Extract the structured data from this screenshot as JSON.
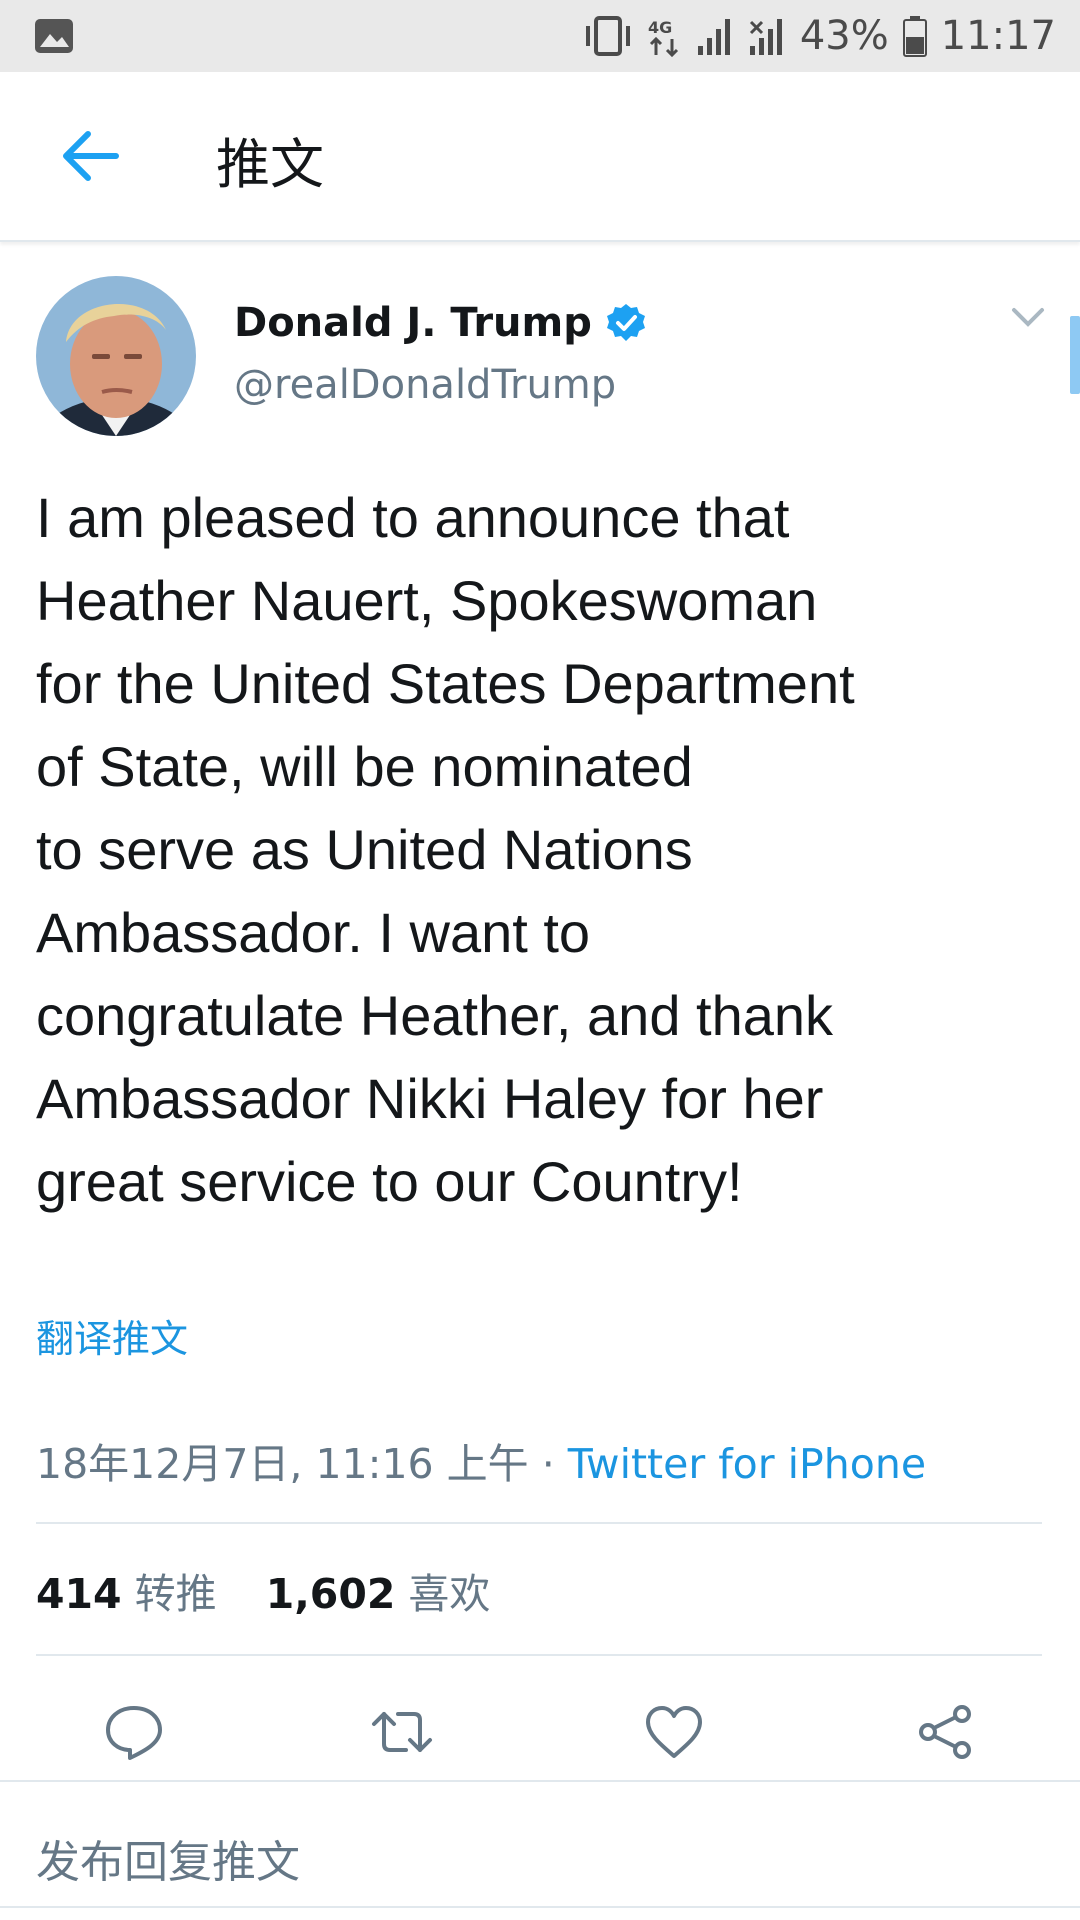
{
  "status_bar": {
    "battery_percent": "43%",
    "time": "11:17",
    "icons": [
      "gallery-notification-icon",
      "vibrate-icon",
      "data-transfer-icon",
      "signal-icon",
      "signal-no-sim-icon",
      "battery-icon"
    ]
  },
  "header": {
    "title": "推文",
    "back_icon": "arrow-left-icon"
  },
  "tweet": {
    "author_name": "Donald J. Trump",
    "handle": "@realDonaldTrump",
    "verified": true,
    "text": "I am pleased to announce that\nHeather Nauert, Spokeswoman\nfor the United States Department\nof State, will be nominated\nto serve as United Nations\nAmbassador. I want to\ncongratulate Heather, and thank\nAmbassador Nikki Haley for her\ngreat service to our Country!",
    "translate_label": "翻译推文",
    "timestamp": "18年12月7日, 11:16 上午",
    "separator": " · ",
    "source": "Twitter for iPhone",
    "retweets_count": "414",
    "retweets_label": "转推",
    "likes_count": "1,602",
    "likes_label": "喜欢"
  },
  "actions": [
    "reply-icon",
    "retweet-icon",
    "like-icon",
    "share-icon"
  ],
  "reply_placeholder": "发布回复推文",
  "colors": {
    "accent": "#1b95e0",
    "verified": "#1da1f2",
    "secondary_text": "#657786",
    "status_bar_bg": "#e9e9e9"
  }
}
